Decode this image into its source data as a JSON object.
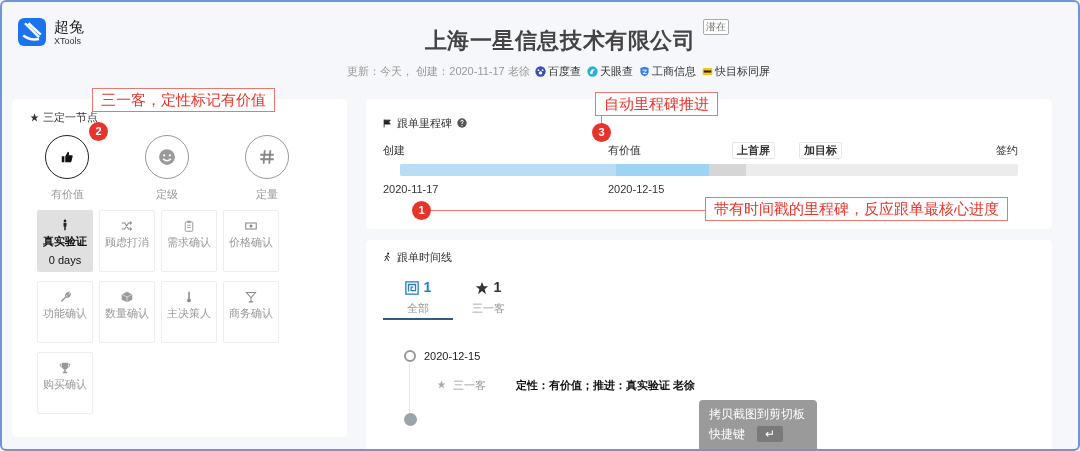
{
  "logo": {
    "name": "超兔",
    "subtitle": "XTools"
  },
  "company": {
    "name": "上海一星信息技术有限公司",
    "badge": "潜在"
  },
  "meta": {
    "text": "更新：今天， 创建：2020-11-17 老徐",
    "links": [
      {
        "label": "百度查",
        "kind": "paw"
      },
      {
        "label": "天眼查",
        "kind": "swirl"
      },
      {
        "label": "工商信息",
        "kind": "shield"
      },
      {
        "label": "快目标同屏",
        "kind": "card"
      }
    ]
  },
  "nodes_panel": {
    "title": "三定一节点",
    "top_nodes": [
      {
        "label": "有价值",
        "kind": "thumb",
        "selected": true
      },
      {
        "label": "定级",
        "kind": "smile",
        "selected": false
      },
      {
        "label": "定量",
        "kind": "hash",
        "selected": false
      }
    ],
    "steps": [
      {
        "label": "真实验证",
        "days": "0 days",
        "kind": "person",
        "selected": true
      },
      {
        "label": "顾虑打消",
        "kind": "shuffle",
        "selected": false
      },
      {
        "label": "需求确认",
        "kind": "clipboard",
        "selected": false
      },
      {
        "label": "价格确认",
        "kind": "money",
        "selected": false
      },
      {
        "label": "功能确认",
        "kind": "wrench",
        "selected": false
      },
      {
        "label": "数量确认",
        "kind": "cube",
        "selected": false
      },
      {
        "label": "主决策人",
        "kind": "thermometer",
        "selected": false
      },
      {
        "label": "商务确认",
        "kind": "glass",
        "selected": false
      },
      {
        "label": "购买确认",
        "kind": "trophy",
        "selected": false
      }
    ]
  },
  "milestones": {
    "title": "跟单里程碑",
    "level": 0.5,
    "stages": [
      {
        "label": "创建",
        "date": "2020-11-17",
        "boxed": false
      },
      {
        "label": "有价值",
        "date": "2020-12-15",
        "boxed": false
      },
      {
        "label": "上首屏",
        "boxed": true
      },
      {
        "label": "加目标",
        "boxed": true
      },
      {
        "label": "签约",
        "boxed": false
      }
    ]
  },
  "timeline": {
    "title": "跟单时间线",
    "tabs": [
      {
        "count": "1",
        "label": "全部",
        "kind": "all",
        "selected": true
      },
      {
        "count": "1",
        "label": "三一客",
        "kind": "star",
        "selected": false
      }
    ],
    "entries": [
      {
        "date": "2020-12-15",
        "tag": "三一客",
        "text": "定性：有价值；推进：真实验证 老徐"
      }
    ]
  },
  "annotations": [
    {
      "number": "2",
      "text": "三一客，定性标记有价值"
    },
    {
      "number": "3",
      "text": "自动里程碑推进"
    },
    {
      "number": "1",
      "text": "带有时间戳的里程碑，反应跟单最核心进度"
    }
  ],
  "overlay": {
    "title": "拷贝截图到剪切板",
    "shortcut_label": "快捷键",
    "key": "↵"
  }
}
